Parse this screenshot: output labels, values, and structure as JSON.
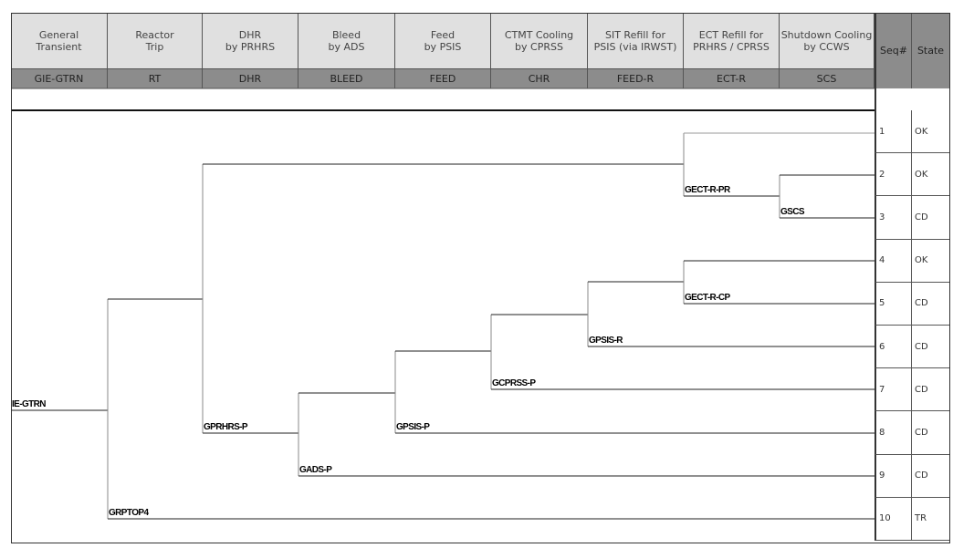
{
  "columns": [
    {
      "title": "General\nTransient",
      "code": "GIE-GTRN"
    },
    {
      "title": "Reactor\nTrip",
      "code": "RT"
    },
    {
      "title": "DHR\nby PRHRS",
      "code": "DHR"
    },
    {
      "title": "Bleed\nby ADS",
      "code": "BLEED"
    },
    {
      "title": "Feed\nby PSIS",
      "code": "FEED"
    },
    {
      "title": "CTMT Cooling\nby CPRSS",
      "code": "CHR"
    },
    {
      "title": "SIT Refill for\nPSIS (via IRWST)",
      "code": "FEED-R"
    },
    {
      "title": "ECT Refill for\nPRHRS / CPRSS",
      "code": "ECT-R"
    },
    {
      "title": "Shutdown Cooling\nby CCWS",
      "code": "SCS"
    }
  ],
  "seq_header": "Seq#",
  "state_header": "State",
  "sequences": [
    {
      "seq": "1",
      "state": "OK"
    },
    {
      "seq": "2",
      "state": "OK"
    },
    {
      "seq": "3",
      "state": "CD"
    },
    {
      "seq": "4",
      "state": "OK"
    },
    {
      "seq": "5",
      "state": "CD"
    },
    {
      "seq": "6",
      "state": "CD"
    },
    {
      "seq": "7",
      "state": "CD"
    },
    {
      "seq": "8",
      "state": "CD"
    },
    {
      "seq": "9",
      "state": "CD"
    },
    {
      "seq": "10",
      "state": "TR"
    }
  ],
  "branch_labels": {
    "initiator": "IE-GTRN",
    "rt": "GRPTOP4",
    "prhrs": "GPRHRS-P",
    "ads": "GADS-P",
    "psis": "GPSIS-P",
    "cprss": "GCPRSS-P",
    "psis_r": "GPSIS-R",
    "ect_cp": "GECT-R-CP",
    "ect_pr": "GECT-R-PR",
    "scs": "GSCS"
  }
}
